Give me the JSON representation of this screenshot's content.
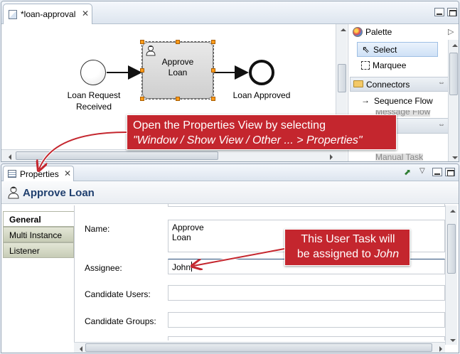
{
  "editor": {
    "tab_title": "*loan-approval",
    "diagram": {
      "start_label_line1": "Loan Request",
      "start_label_line2": "Received",
      "task_label_line1": "Approve",
      "task_label_line2": "Loan",
      "end_label": "Loan Approved"
    }
  },
  "palette": {
    "title": "Palette",
    "select": "Select",
    "marquee": "Marquee",
    "connectors": "Connectors",
    "sequence_flow": "Sequence Flow",
    "message_flow": "Message Flow",
    "manual_task": "Manual Task"
  },
  "callouts": {
    "properties_line1": "Open the Properties View by selecting",
    "properties_line2": "\"Window / Show View / Other ... > Properties\"",
    "assignee_line1": "This User Task will",
    "assignee_line2_prefix": "be assigned to ",
    "assignee_line2_name": "John",
    "color": "#c4262e"
  },
  "properties": {
    "tab_title": "Properties",
    "header_title": "Approve Loan",
    "side_tabs": [
      "General",
      "Multi Instance",
      "Listener"
    ],
    "fields": {
      "name_label": "Name:",
      "name_value_line1": "Approve",
      "name_value_line2": "Loan",
      "assignee_label": "Assignee:",
      "assignee_value": "John",
      "candidate_users_label": "Candidate Users:",
      "candidate_users_value": "",
      "candidate_groups_label": "Candidate Groups:",
      "candidate_groups_value": ""
    }
  },
  "icons": [
    "file-icon",
    "close-icon",
    "minimize-icon",
    "maximize-icon",
    "palette-icon",
    "select-arrow-icon",
    "marquee-icon",
    "folder-icon",
    "sequence-flow-icon",
    "user-task-icon",
    "properties-view-icon",
    "pin-icon",
    "view-menu-icon"
  ]
}
